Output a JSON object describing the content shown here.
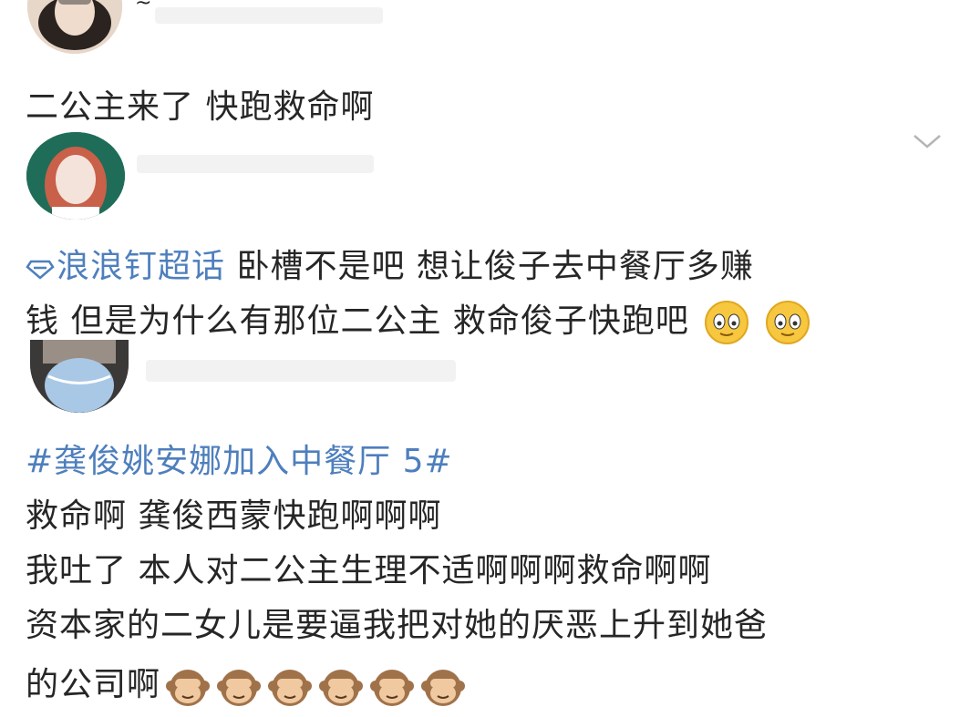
{
  "post1": {
    "username_stub": "~",
    "text": "二公主来了 快跑救命啊"
  },
  "post2": {
    "supertopic_name": "浪浪钉超话",
    "line1_rest": " 卧槽不是吧 想让俊子去中餐厅多赚",
    "line2": "钱 但是为什么有那位二公主 救命俊子快跑吧",
    "emoji": "sweat-smile-emoji",
    "emoji_count": 2
  },
  "post3": {
    "hashtag": "#龚俊姚安娜加入中餐厅 5#",
    "lines": [
      "救命啊 龚俊西蒙快跑啊啊啊",
      "我吐了 本人对二公主生理不适啊啊啊救命啊啊",
      "资本家的二女儿是要逼我把对她的厌恶上升到她爸",
      "的公司啊"
    ],
    "emoji": "see-no-evil-monkey-emoji",
    "emoji_count": 6
  },
  "icons": {
    "collapse": "chevron-down-icon",
    "supertopic": "diamond-icon"
  },
  "colors": {
    "topic_blue": "#4e7fbd",
    "text": "#262626"
  }
}
